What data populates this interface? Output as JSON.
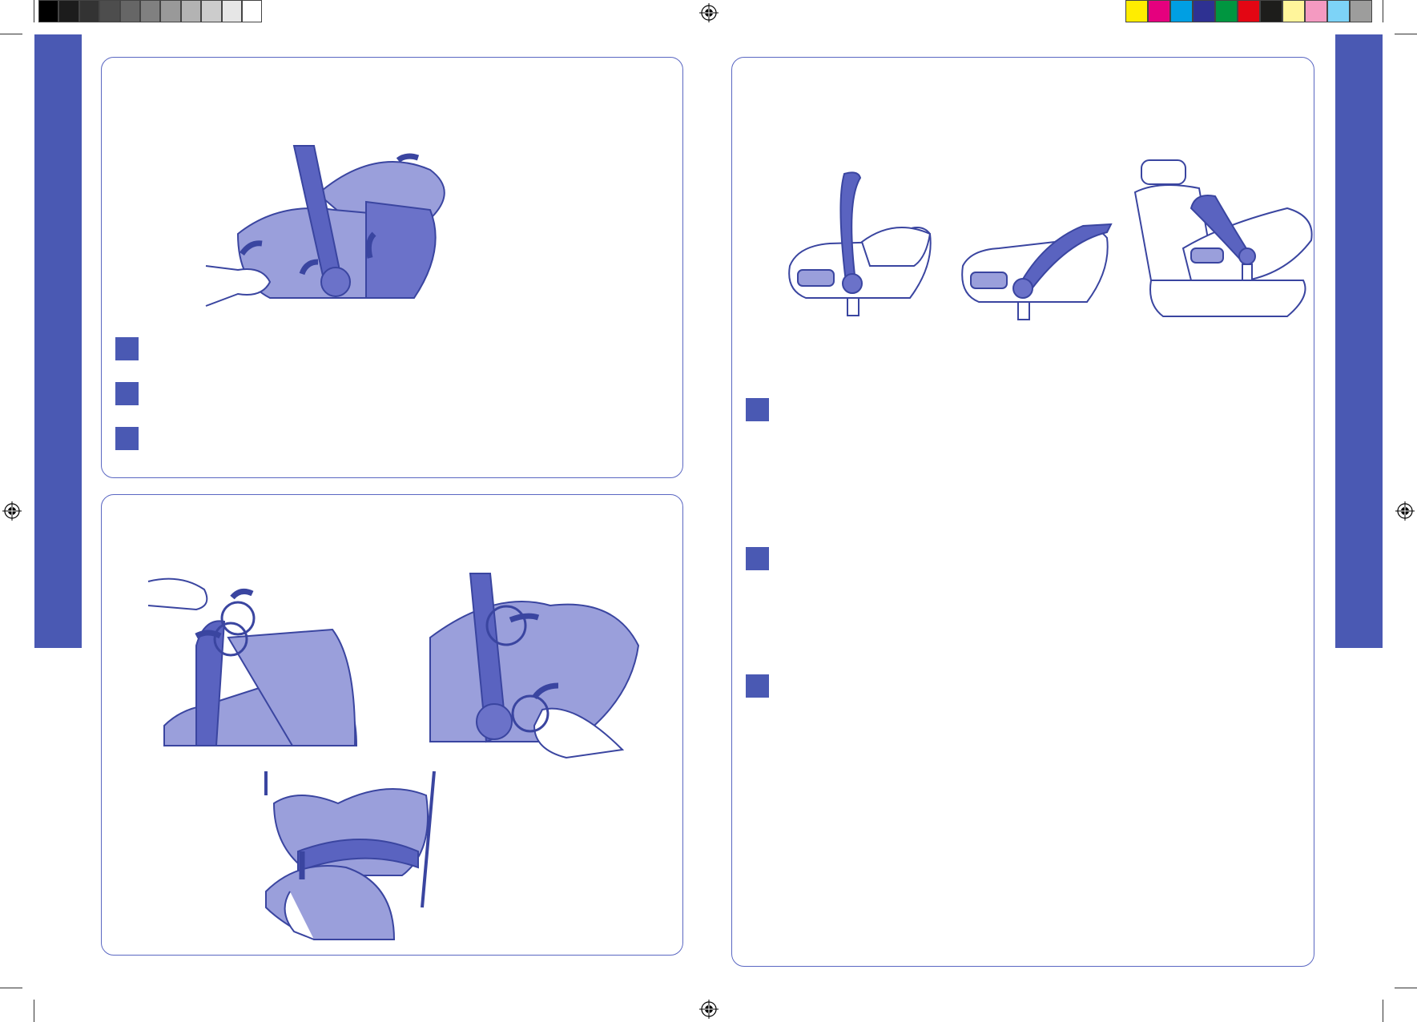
{
  "colors": {
    "accent": "#4a59b3",
    "panel_border": "#5a67c2",
    "illustration_fill": "#9a9fdb",
    "illustration_dark": "#6b72c9",
    "illustration_stroke": "#3a45a0"
  },
  "print_marks": {
    "grayscale_bar": [
      "#000000",
      "#1c1c1c",
      "#333333",
      "#4d4d4d",
      "#666666",
      "#808080",
      "#999999",
      "#b3b3b3",
      "#cccccc",
      "#e6e6e6",
      "#ffffff"
    ],
    "color_bar": [
      "#ffed00",
      "#e5007e",
      "#009fe3",
      "#2e3192",
      "#009640",
      "#e30613",
      "#1d1d1b",
      "#fff59b",
      "#f49ac1",
      "#7dd3f7",
      "#9d9d9c"
    ]
  },
  "icons": {
    "registration": "registration-mark-icon",
    "arrow": "curved-arrow-icon",
    "step_marker": "step-square-icon"
  }
}
